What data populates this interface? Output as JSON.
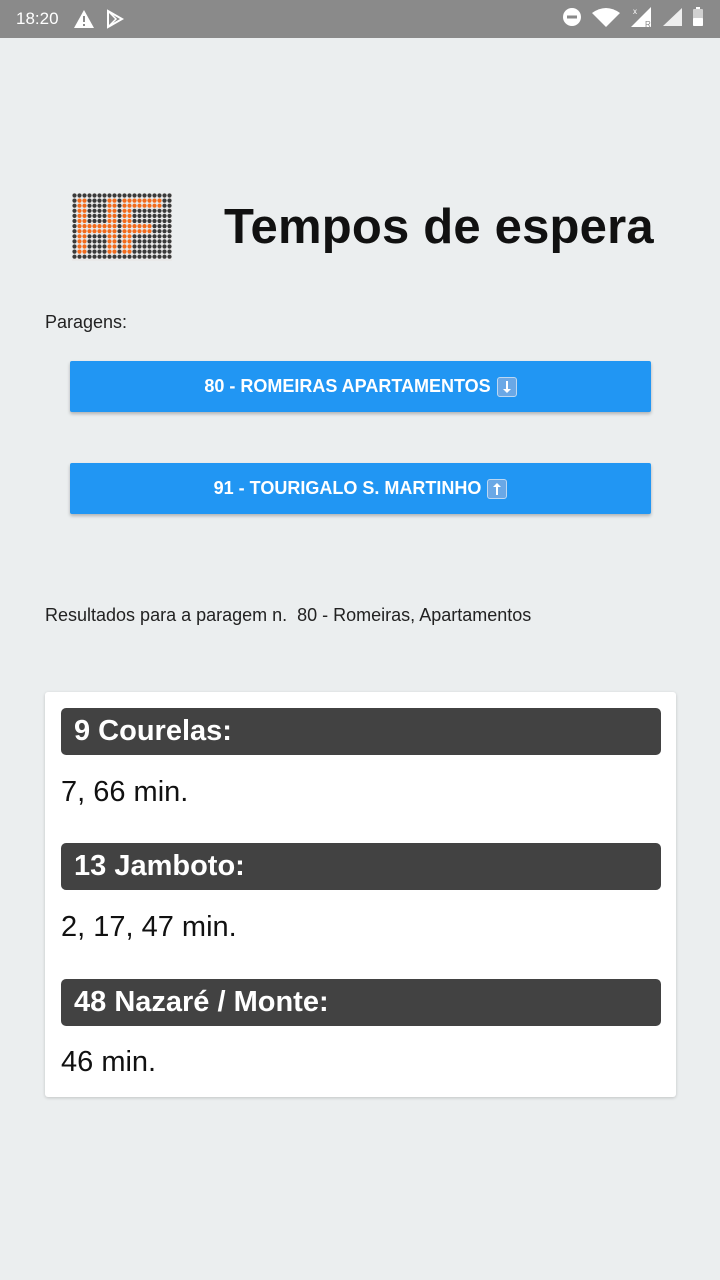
{
  "status_bar": {
    "time": "18:20",
    "icons_left": [
      "warning-icon",
      "play-store-icon"
    ],
    "icons_right": [
      "do-not-disturb-icon",
      "wifi-icon",
      "signal-icon",
      "signal-icon-2",
      "battery-icon"
    ]
  },
  "header": {
    "logo_text": "HF",
    "title": "Tempos de espera"
  },
  "stops": {
    "label": "Paragens:",
    "buttons": [
      {
        "label": "80 - ROMEIRAS APARTAMENTOS",
        "arrow": "down"
      },
      {
        "label": "91 - TOURIGALO S. MARTINHO",
        "arrow": "up"
      }
    ]
  },
  "results": {
    "label": "Resultados para a paragem n.  80 - Romeiras, Apartamentos",
    "lines": [
      {
        "name": "9 Courelas:",
        "times": "7, 66 min."
      },
      {
        "name": "13 Jamboto:",
        "times": "2, 17, 47 min."
      },
      {
        "name": "48 Nazaré / Monte:",
        "times": "46 min."
      }
    ]
  },
  "colors": {
    "accent": "#2196f3",
    "header_bg": "#424242",
    "status_bar": "#8a8a8a",
    "background": "#ebeeef",
    "logo_orange": "#f26a1b"
  }
}
